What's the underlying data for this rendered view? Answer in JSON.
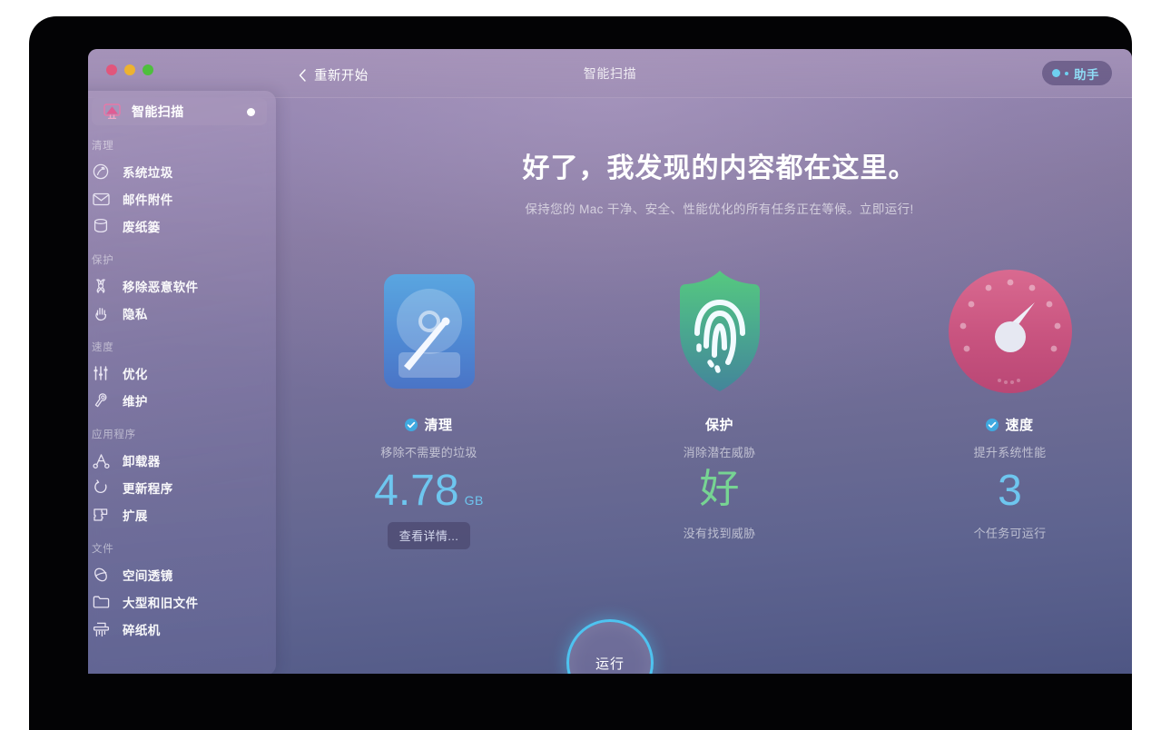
{
  "window": {
    "traffic_lights": [
      "close",
      "minimize",
      "maximize"
    ],
    "colors": {
      "close": "#e1567c",
      "minimize": "#edb230",
      "maximize": "#4ebf3d",
      "accent_blue": "#6ec6ef",
      "accent_green": "#77d493",
      "ring_cyan": "#4ec3f0"
    }
  },
  "titlebar": {
    "back_label": "重新开始",
    "title": "智能扫描",
    "assistant_label": "助手"
  },
  "sidebar": {
    "selected": {
      "label": "智能扫描",
      "icon": "monitor-scan-icon"
    },
    "groups": [
      {
        "heading": "清理",
        "items": [
          {
            "label": "系统垃圾",
            "icon": "broom-circle-icon"
          },
          {
            "label": "邮件附件",
            "icon": "envelope-icon"
          },
          {
            "label": "废纸篓",
            "icon": "trash-bin-icon"
          }
        ]
      },
      {
        "heading": "保护",
        "items": [
          {
            "label": "移除恶意软件",
            "icon": "biohazard-icon"
          },
          {
            "label": "隐私",
            "icon": "hand-icon"
          }
        ]
      },
      {
        "heading": "速度",
        "items": [
          {
            "label": "优化",
            "icon": "sliders-icon"
          },
          {
            "label": "维护",
            "icon": "wrench-icon"
          }
        ]
      },
      {
        "heading": "应用程序",
        "items": [
          {
            "label": "卸载器",
            "icon": "uninstaller-icon"
          },
          {
            "label": "更新程序",
            "icon": "refresh-icon"
          },
          {
            "label": "扩展",
            "icon": "puzzle-icon"
          }
        ]
      },
      {
        "heading": "文件",
        "items": [
          {
            "label": "空间透镜",
            "icon": "space-lens-icon"
          },
          {
            "label": "大型和旧文件",
            "icon": "folder-icon"
          },
          {
            "label": "碎纸机",
            "icon": "shredder-icon"
          }
        ]
      }
    ]
  },
  "main": {
    "heading": "好了，我发现的内容都在这里。",
    "subheading": "保持您的 Mac 干净、安全、性能优化的所有任务正在等候。立即运行!",
    "cards": [
      {
        "icon": "hard-drive-icon",
        "title": "清理",
        "has_check": true,
        "subtitle": "移除不需要的垃圾",
        "metric": "4.78",
        "unit": "GB",
        "metric_color": "blue",
        "footer": "",
        "button": "查看详情..."
      },
      {
        "icon": "shield-fingerprint-icon",
        "title": "保护",
        "has_check": false,
        "subtitle": "消除潜在威胁",
        "metric": "好",
        "unit": "",
        "metric_color": "green",
        "footer": "没有找到威胁",
        "button": ""
      },
      {
        "icon": "speedometer-icon",
        "title": "速度",
        "has_check": true,
        "subtitle": "提升系统性能",
        "metric": "3",
        "unit": "",
        "metric_color": "blue",
        "footer": "个任务可运行",
        "button": ""
      }
    ],
    "run_button": "运行"
  }
}
